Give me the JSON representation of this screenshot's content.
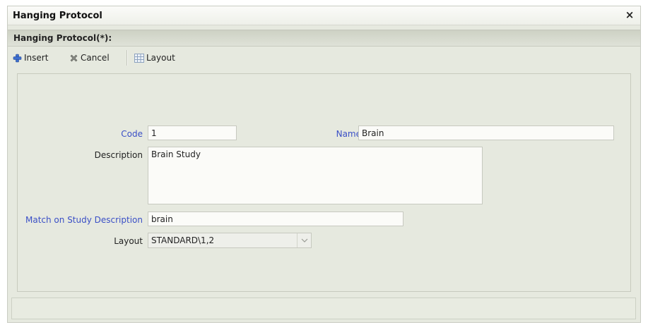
{
  "window": {
    "title": "Hanging Protocol",
    "close_symbol": "×"
  },
  "panel": {
    "header": "Hanging Protocol(*):"
  },
  "toolbar": {
    "insert_label": "Insert",
    "insert_icon": "plus-icon",
    "cancel_label": "Cancel",
    "cancel_icon": "x-icon",
    "layout_label": "Layout",
    "layout_icon": "grid-icon"
  },
  "form": {
    "code": {
      "label": "Code",
      "value": "1"
    },
    "name": {
      "label": "Name",
      "value": "Brain"
    },
    "description": {
      "label": "Description",
      "value": "Brain Study"
    },
    "match": {
      "label": "Match on Study Description",
      "value": "brain"
    },
    "layout": {
      "label": "Layout",
      "value": "STANDARD\\1,2"
    }
  },
  "colors": {
    "required_label": "#3a4fc6",
    "background": "#e6e9df",
    "insert_icon": "#3d6fd0",
    "cancel_icon": "#8a8c86"
  }
}
